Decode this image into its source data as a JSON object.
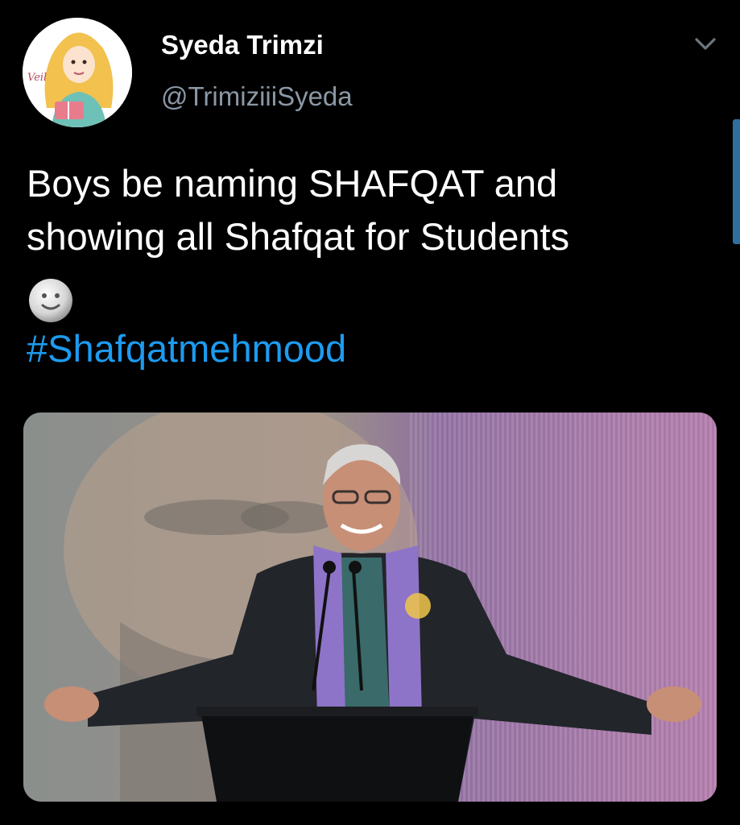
{
  "tweet": {
    "author": {
      "display_name": "Syeda Trimzi",
      "handle": "@TrimiziiiSyeda",
      "avatar_icon": "avatar-illustration",
      "avatar_text": "Veil"
    },
    "menu_icon": "chevron-down-icon",
    "text_lines": [
      "Boys be naming SHAFQAT and",
      "showing all Shafqat for Students"
    ],
    "emoji": "slightly-smiling-face-emoji",
    "hashtag": "#Shafqatmehmood",
    "media": {
      "type": "photo",
      "icon": "photo-man-at-podium"
    }
  },
  "colors": {
    "background": "#000000",
    "name": "#ffffff",
    "handle": "#8b98a5",
    "body_text": "#ffffff",
    "link": "#1d9bf0",
    "scroll_indicator": "#2f6f9f"
  }
}
